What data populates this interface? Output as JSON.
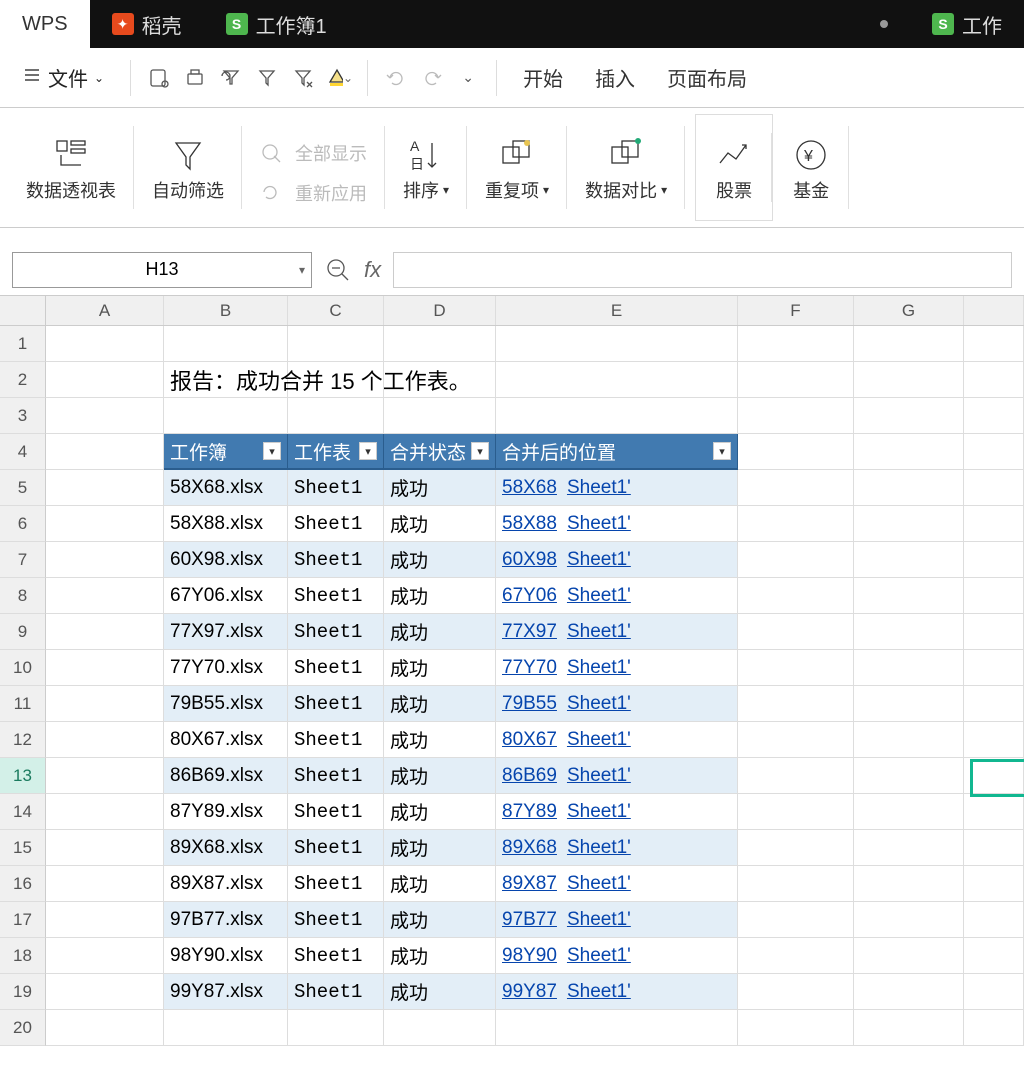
{
  "tabs": {
    "wps": "WPS",
    "doc": "稻壳",
    "book1": "工作簿1",
    "book2": "工作"
  },
  "topmenu": {
    "file": "文件",
    "start": "开始",
    "insert": "插入",
    "pagelayout": "页面布局"
  },
  "ribbon": {
    "pivot": "数据透视表",
    "autofilter": "自动筛选",
    "showall": "全部显示",
    "reapply": "重新应用",
    "sort": "排序",
    "dup": "重复项",
    "compare": "数据对比",
    "stock": "股票",
    "fund": "基金"
  },
  "formula": {
    "namebox": "H13",
    "value": ""
  },
  "columns": [
    "A",
    "B",
    "C",
    "D",
    "E",
    "F",
    "G"
  ],
  "report_text": "报告：成功合并 15 个工作表。",
  "table_headers": {
    "wb": "工作簿",
    "ws": "工作表",
    "stat": "合并状态",
    "loc": "合并后的位置"
  },
  "rows": [
    {
      "wb": "58X68.xlsx",
      "ws": "Sheet1",
      "stat": "成功",
      "loc1": "58X68",
      "loc2": "Sheet1'"
    },
    {
      "wb": "58X88.xlsx",
      "ws": "Sheet1",
      "stat": "成功",
      "loc1": "58X88",
      "loc2": "Sheet1'"
    },
    {
      "wb": "60X98.xlsx",
      "ws": "Sheet1",
      "stat": "成功",
      "loc1": "60X98",
      "loc2": "Sheet1'"
    },
    {
      "wb": "67Y06.xlsx",
      "ws": "Sheet1",
      "stat": "成功",
      "loc1": "67Y06",
      "loc2": "Sheet1'"
    },
    {
      "wb": "77X97.xlsx",
      "ws": "Sheet1",
      "stat": "成功",
      "loc1": "77X97",
      "loc2": "Sheet1'"
    },
    {
      "wb": "77Y70.xlsx",
      "ws": "Sheet1",
      "stat": "成功",
      "loc1": "77Y70",
      "loc2": "Sheet1'"
    },
    {
      "wb": "79B55.xlsx",
      "ws": "Sheet1",
      "stat": "成功",
      "loc1": "79B55",
      "loc2": "Sheet1'"
    },
    {
      "wb": "80X67.xlsx",
      "ws": "Sheet1",
      "stat": "成功",
      "loc1": "80X67",
      "loc2": "Sheet1'"
    },
    {
      "wb": "86B69.xlsx",
      "ws": "Sheet1",
      "stat": "成功",
      "loc1": "86B69",
      "loc2": "Sheet1'"
    },
    {
      "wb": "87Y89.xlsx",
      "ws": "Sheet1",
      "stat": "成功",
      "loc1": "87Y89",
      "loc2": "Sheet1'"
    },
    {
      "wb": "89X68.xlsx",
      "ws": "Sheet1",
      "stat": "成功",
      "loc1": "89X68",
      "loc2": "Sheet1'"
    },
    {
      "wb": "89X87.xlsx",
      "ws": "Sheet1",
      "stat": "成功",
      "loc1": "89X87",
      "loc2": "Sheet1'"
    },
    {
      "wb": "97B77.xlsx",
      "ws": "Sheet1",
      "stat": "成功",
      "loc1": "97B77",
      "loc2": "Sheet1'"
    },
    {
      "wb": "98Y90.xlsx",
      "ws": "Sheet1",
      "stat": "成功",
      "loc1": "98Y90",
      "loc2": "Sheet1'"
    },
    {
      "wb": "99Y87.xlsx",
      "ws": "Sheet1",
      "stat": "成功",
      "loc1": "99Y87",
      "loc2": "Sheet1'"
    }
  ],
  "row_numbers": [
    1,
    2,
    3,
    4,
    5,
    6,
    7,
    8,
    9,
    10,
    11,
    12,
    13,
    14,
    15,
    16,
    17,
    18,
    19,
    20
  ],
  "selected_row": 13
}
